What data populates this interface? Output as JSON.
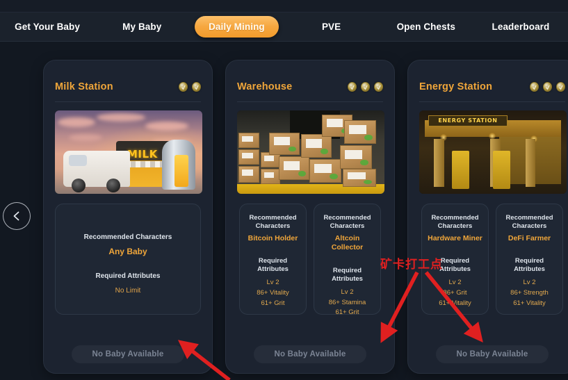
{
  "nav": {
    "items": [
      {
        "label": "Get Your Baby",
        "active": false
      },
      {
        "label": "My Baby",
        "active": false
      },
      {
        "label": "Daily Mining",
        "active": true
      },
      {
        "label": "PVE",
        "active": false
      },
      {
        "label": "Open Chests",
        "active": false
      },
      {
        "label": "Leaderboard",
        "active": false
      }
    ]
  },
  "carousel": {
    "prev_icon": "chevron-left-icon"
  },
  "labels": {
    "recommended": "Recommended Characters",
    "recommended_l1": "Recommended",
    "recommended_l2": "Characters",
    "required": "Required Attributes",
    "cta": "No Baby Available"
  },
  "cards": [
    {
      "title": "Milk Station",
      "coins": 2,
      "art": "milk-station-artwork",
      "art_sign": "MILK",
      "panels": [
        {
          "recommended": "Any Baby",
          "required": [
            "No Limit"
          ]
        }
      ],
      "cta": "No Baby Available"
    },
    {
      "title": "Warehouse",
      "coins": 3,
      "art": "warehouse-artwork",
      "panels": [
        {
          "recommended": "Bitcoin Holder",
          "required": [
            "Lv 2",
            "86+ Vitality",
            "61+ Grit"
          ]
        },
        {
          "recommended": "Altcoin Collector",
          "required": [
            "Lv 2",
            "86+ Stamina",
            "61+ Grit"
          ]
        }
      ],
      "cta": "No Baby Available"
    },
    {
      "title": "Energy Station",
      "coins": 3,
      "art": "energy-station-artwork",
      "art_sign": "ENERGY STATION",
      "panels": [
        {
          "recommended": "Hardware Miner",
          "required": [
            "Lv 2",
            "86+ Grit",
            "61+ Vitality"
          ]
        },
        {
          "recommended": "DeFi Farmer",
          "required": [
            "Lv 2",
            "86+ Strength",
            "61+ Vitality"
          ]
        }
      ],
      "cta": "No Baby Available"
    }
  ],
  "annotation": {
    "text": "矿卡打工点",
    "color": "#e02020"
  },
  "colors": {
    "accent": "#f0a63a",
    "page_bg": "#121821",
    "card_bg": "#1c2330",
    "panel_bg": "#1f2734",
    "nav_bg": "#1b222c",
    "cta_bg": "#262d3a",
    "cta_text": "#7b8494",
    "annotation_red": "#e02020"
  }
}
